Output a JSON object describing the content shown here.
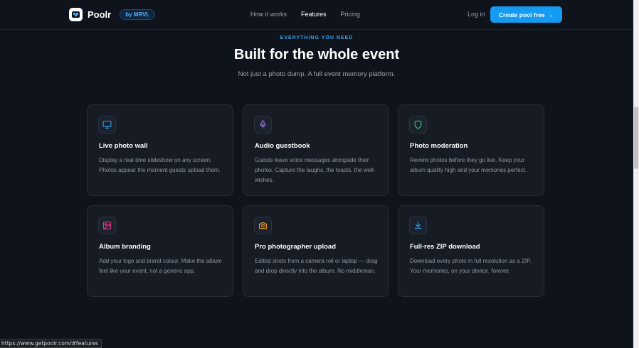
{
  "nav": {
    "logo_text": "Poolr",
    "badge": "by MRVL",
    "links": [
      "How it works",
      "Features",
      "Pricing"
    ],
    "active_link": "Features",
    "login": "Log in",
    "cta": "Create pool free",
    "cta_arrow": "→"
  },
  "section": {
    "eyebrow": "EVERYTHING YOU NEED",
    "title": "Built for the whole event",
    "subtitle": "Not just a photo dump. A full event memory platform."
  },
  "features": [
    {
      "icon": "monitor-icon",
      "color": "#2ea7f5",
      "title": "Live photo wall",
      "desc": "Display a real-time slideshow on any screen. Photos appear the moment guests upload them."
    },
    {
      "icon": "microphone-icon",
      "color": "#9b7bf5",
      "title": "Audio guestbook",
      "desc": "Guests leave voice messages alongside their photos. Capture the laughs, the toasts, the well-wishes."
    },
    {
      "icon": "shield-icon",
      "color": "#2fd17a",
      "title": "Photo moderation",
      "desc": "Review photos before they go live. Keep your album quality high and your memories perfect."
    },
    {
      "icon": "image-icon",
      "color": "#f0459a",
      "title": "Album branding",
      "desc": "Add your logo and brand colour. Make the album feel like your event, not a generic app."
    },
    {
      "icon": "camera-icon",
      "color": "#f5a623",
      "title": "Pro photographer upload",
      "desc": "Edited shots from a camera roll or laptop — drag and drop directly into the album. No middleman."
    },
    {
      "icon": "download-icon",
      "color": "#2ea7f5",
      "title": "Full-res ZIP download",
      "desc": "Download every photo in full resolution as a ZIP. Your memories, on your device, forever."
    }
  ],
  "status_url": "https://www.getpoolr.com/#features"
}
